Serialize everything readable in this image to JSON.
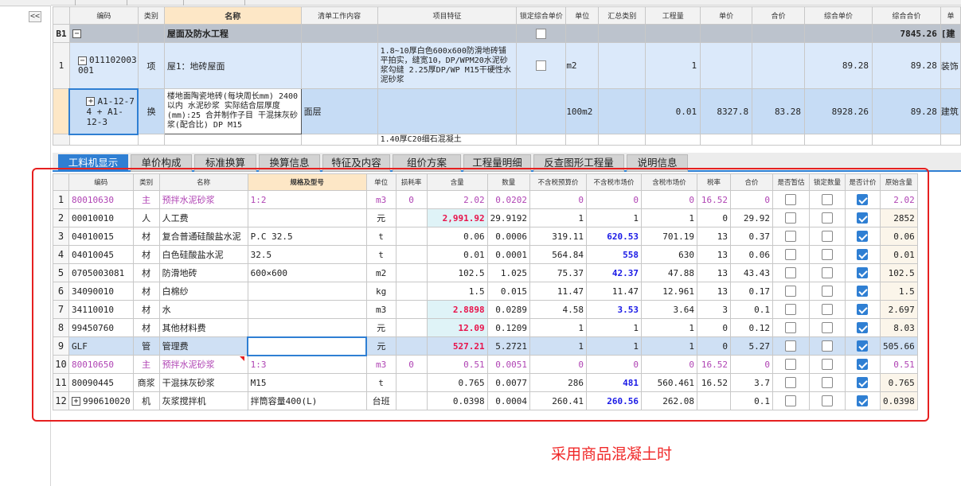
{
  "colors": {
    "accent": "#2f7fd3",
    "highlight_header": "#fde7c6",
    "red_text": "#e8124a",
    "blue_text": "#1a1ae6",
    "purple_text": "#b044b4",
    "outline": "#e62020"
  },
  "top_grid": {
    "headers": [
      "编码",
      "类别",
      "名称",
      "清单工作内容",
      "项目特征",
      "锁定综合单价",
      "单位",
      "汇总类别",
      "工程量",
      "单价",
      "合价",
      "综合单价",
      "综合合价",
      "单"
    ],
    "group_row": {
      "id": "B1",
      "toggle": "−",
      "name": "屋面及防水工程",
      "total": "7845.26",
      "tail": "[建"
    },
    "item_row": {
      "index": "1",
      "toggle": "−",
      "code": "011102003001",
      "type": "项",
      "name": "屋1：地砖屋面",
      "feature": "1.8~10厚白色600x600防滑地砖铺平拍实，缝宽10，DP/WPM20水泥砂浆勾缝 2.25厚DP/WP M15干硬性水泥砂浆",
      "unit": "m2",
      "qty": "1",
      "comp_price": "89.28",
      "comp_total": "89.28",
      "tail": "装饰"
    },
    "sub_row": {
      "toggle": "+",
      "code": "A1-12-7 4 + A1-12-3",
      "type": "换",
      "name": "楼地面陶瓷地砖(每块周长mm) 2400以内 水泥砂浆 实际结合层厚度(mm):25 合并制作子目 干混抹灰砂浆(配合比) DP M15",
      "content": "面层",
      "unit": "100m2",
      "qty": "0.01",
      "price": "8327.8",
      "total": "83.28",
      "comp_price": "8928.26",
      "comp_total": "89.28",
      "tail": "建筑"
    },
    "next_row": {
      "feature": "1.40厚C20细石混凝土"
    }
  },
  "tabs": [
    "工料机显示",
    "单价构成",
    "标准换算",
    "换算信息",
    "特征及内容",
    "组价方案",
    "工程量明细",
    "反查图形工程量",
    "说明信息"
  ],
  "bottom_grid": {
    "headers": [
      "",
      "编码",
      "类别",
      "名称",
      "规格及型号",
      "单位",
      "损耗率",
      "含量",
      "数量",
      "不含税预算价",
      "不含税市场价",
      "含税市场价",
      "税率",
      "合价",
      "是否暂估",
      "锁定数量",
      "是否计价",
      "原始含量"
    ],
    "rows": [
      {
        "n": "1",
        "code": "80010630",
        "type": "主",
        "name": "预拌水泥砂浆",
        "spec": "1:2",
        "unit": "m3",
        "loss": "0",
        "content": "2.02",
        "qty": "0.0202",
        "budget": "0",
        "market": "0",
        "market_tax": "0",
        "tax": "16.52",
        "total": "0",
        "orig": "2.02"
      },
      {
        "n": "2",
        "code": "00010010",
        "type": "人",
        "name": "人工费",
        "spec": "",
        "unit": "元",
        "loss": "",
        "content": "2,991.92",
        "qty": "29.9192",
        "budget": "1",
        "market": "1",
        "market_tax": "1",
        "tax": "0",
        "total": "29.92",
        "orig": "2852"
      },
      {
        "n": "3",
        "code": "04010015",
        "type": "材",
        "name": "复合普通硅酸盐水泥",
        "spec": "P.C 32.5",
        "unit": "t",
        "loss": "",
        "content": "0.06",
        "qty": "0.0006",
        "budget": "319.11",
        "market": "620.53",
        "market_tax": "701.19",
        "tax": "13",
        "total": "0.37",
        "orig": "0.06"
      },
      {
        "n": "4",
        "code": "04010045",
        "type": "材",
        "name": "白色硅酸盐水泥",
        "spec": "32.5",
        "unit": "t",
        "loss": "",
        "content": "0.01",
        "qty": "0.0001",
        "budget": "564.84",
        "market": "558",
        "market_tax": "630",
        "tax": "13",
        "total": "0.06",
        "orig": "0.01"
      },
      {
        "n": "5",
        "code": "0705003081",
        "type": "材",
        "name": "防滑地砖",
        "spec": "600×600",
        "unit": "m2",
        "loss": "",
        "content": "102.5",
        "qty": "1.025",
        "budget": "75.37",
        "market": "42.37",
        "market_tax": "47.88",
        "tax": "13",
        "total": "43.43",
        "orig": "102.5"
      },
      {
        "n": "6",
        "code": "34090010",
        "type": "材",
        "name": "白棉纱",
        "spec": "",
        "unit": "kg",
        "loss": "",
        "content": "1.5",
        "qty": "0.015",
        "budget": "11.47",
        "market": "11.47",
        "market_tax": "12.961",
        "tax": "13",
        "total": "0.17",
        "orig": "1.5"
      },
      {
        "n": "7",
        "code": "34110010",
        "type": "材",
        "name": "水",
        "spec": "",
        "unit": "m3",
        "loss": "",
        "content": "2.8898",
        "qty": "0.0289",
        "budget": "4.58",
        "market": "3.53",
        "market_tax": "3.64",
        "tax": "3",
        "total": "0.1",
        "orig": "2.697"
      },
      {
        "n": "8",
        "code": "99450760",
        "type": "材",
        "name": "其他材料费",
        "spec": "",
        "unit": "元",
        "loss": "",
        "content": "12.09",
        "qty": "0.1209",
        "budget": "1",
        "market": "1",
        "market_tax": "1",
        "tax": "0",
        "total": "0.12",
        "orig": "8.03"
      },
      {
        "n": "9",
        "code": "GLF",
        "type": "管",
        "name": "管理费",
        "spec": "",
        "unit": "元",
        "loss": "",
        "content": "527.21",
        "qty": "5.2721",
        "budget": "1",
        "market": "1",
        "market_tax": "1",
        "tax": "0",
        "total": "5.27",
        "orig": "505.66"
      },
      {
        "n": "10",
        "code": "80010650",
        "type": "主",
        "name": "预拌水泥砂浆",
        "spec": "1:3",
        "unit": "m3",
        "loss": "0",
        "content": "0.51",
        "qty": "0.0051",
        "budget": "0",
        "market": "0",
        "market_tax": "0",
        "tax": "16.52",
        "total": "0",
        "orig": "0.51"
      },
      {
        "n": "11",
        "code": "80090445",
        "type": "商浆",
        "name": "干混抹灰砂浆",
        "spec": "M15",
        "unit": "t",
        "loss": "",
        "content": "0.765",
        "qty": "0.0077",
        "budget": "286",
        "market": "481",
        "market_tax": "560.461",
        "tax": "16.52",
        "total": "3.7",
        "orig": "0.765"
      },
      {
        "n": "12",
        "code": "990610020",
        "type": "机",
        "name": "灰浆搅拌机",
        "spec": "拌筒容量400(L)",
        "unit": "台班",
        "loss": "",
        "content": "0.0398",
        "qty": "0.0004",
        "budget": "260.41",
        "market": "260.56",
        "market_tax": "262.08",
        "tax": "",
        "total": "0.1",
        "orig": "0.0398"
      }
    ]
  },
  "caption": "采用商品混凝土时",
  "left_panel": {
    "collapse": "<<"
  }
}
